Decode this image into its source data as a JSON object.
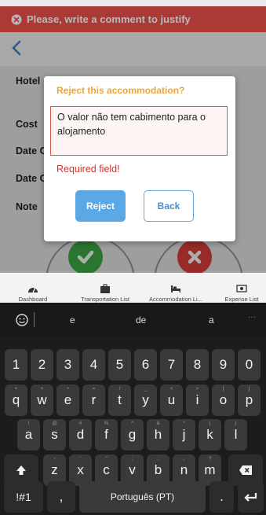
{
  "toast": {
    "message": "Please, write a comment to justify",
    "icon": "x-circle-icon"
  },
  "fields": {
    "hotel": "Hotel",
    "cost": "Cost",
    "date_c1": "Date C",
    "date_c2": "Date C",
    "note": "Note"
  },
  "dialog": {
    "title": "Reject this accommodation?",
    "comment_value": "O valor não tem cabimento para o alojamento",
    "error": "Required field!",
    "reject_label": "Reject",
    "back_label": "Back"
  },
  "bottom_nav": [
    {
      "label": "Dashboard",
      "icon": "dashboard-icon"
    },
    {
      "label": "Transportation List",
      "icon": "briefcase-icon"
    },
    {
      "label": "Accommodation Li...",
      "icon": "bed-icon"
    },
    {
      "label": "Expense List",
      "icon": "money-icon"
    }
  ],
  "keyboard": {
    "suggestions": [
      "e",
      "de",
      "a"
    ],
    "more": "···",
    "numbers": [
      "1",
      "2",
      "3",
      "4",
      "5",
      "6",
      "7",
      "8",
      "9",
      "0"
    ],
    "row1": [
      "q",
      "w",
      "e",
      "r",
      "t",
      "y",
      "u",
      "i",
      "o",
      "p"
    ],
    "row1_hints": [
      "+",
      "×",
      "÷",
      "=",
      "/",
      "_",
      "<",
      ">",
      "[",
      "]"
    ],
    "row2": [
      "a",
      "s",
      "d",
      "f",
      "g",
      "h",
      "j",
      "k",
      "l"
    ],
    "row2_hints": [
      "!",
      "@",
      "#",
      "%",
      "^",
      "&",
      "*",
      "(",
      ")"
    ],
    "row3": [
      "z",
      "x",
      "c",
      "v",
      "b",
      "n",
      "m"
    ],
    "row3_hints": [
      "-",
      "'",
      "\"",
      ":",
      ";",
      ",",
      "?"
    ],
    "symbols_label": "!#1",
    "comma": ",",
    "space_label": "Português (PT)",
    "period": "."
  },
  "colors": {
    "toast": "#ee4f4c",
    "dialog_title": "#f0a530",
    "primary_button": "#5aa9e6",
    "error": "#d0332f",
    "accept": "#3fae49",
    "reject": "#e0413c"
  }
}
